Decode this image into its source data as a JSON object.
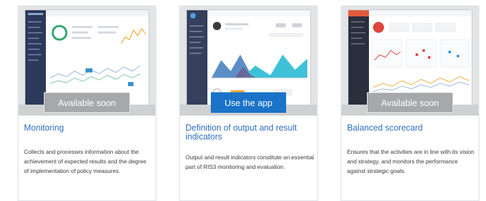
{
  "cards": [
    {
      "title": "Monitoring",
      "button": "Available soon",
      "description": "Collects and processes information about the achievement of expected results and the degree of implementation of policy measures."
    },
    {
      "title": "Definition of output and result indicators",
      "button": "Use the app",
      "description": "Output and result indicators constitute an essential part of RIS3 monitoring and evaluation."
    },
    {
      "title": "Balanced scorecard",
      "button": "Available soon",
      "description": "Ensures that the activities are in line with its vision and strategy, and monitors the performance against strategic goals."
    }
  ],
  "colors": {
    "accent": "#2e6fc0",
    "primary_button": "#1a73c8",
    "disabled_button": "#a6a8ab",
    "sidebar_dark": "#2f3d5c"
  }
}
